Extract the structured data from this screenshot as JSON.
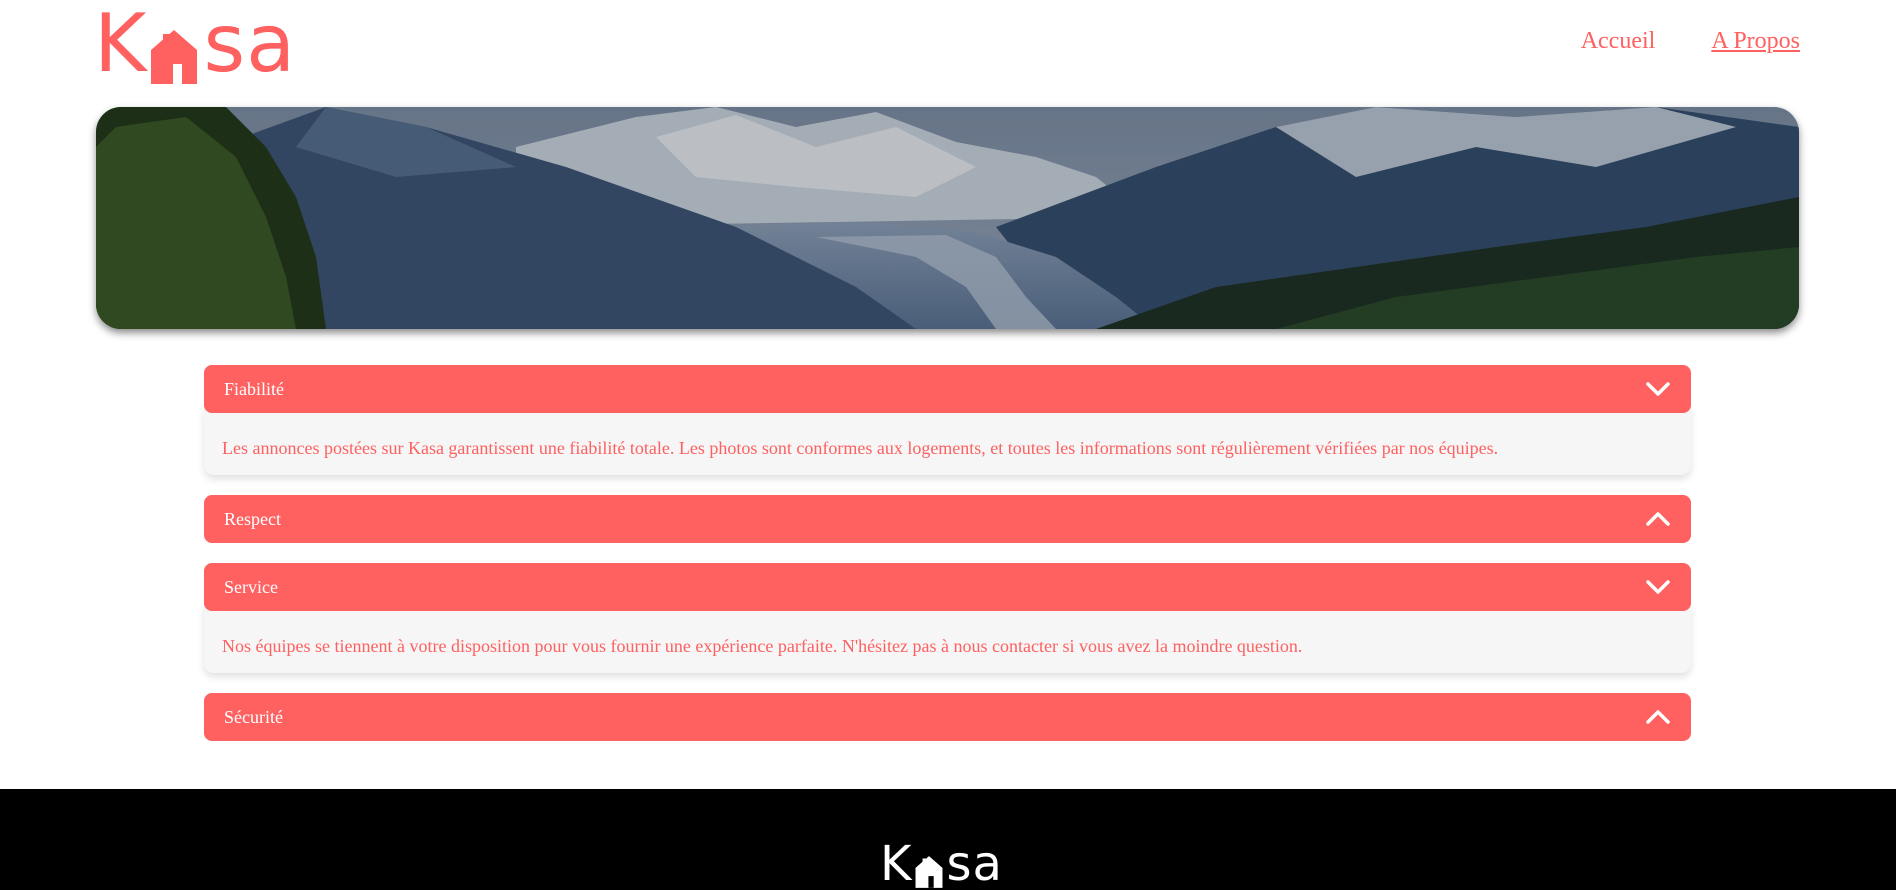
{
  "header": {
    "logo": {
      "text_before": "K",
      "text_after": "sa",
      "brand_color": "#ff6060"
    },
    "nav": [
      {
        "label": "Accueil",
        "active": false
      },
      {
        "label": "A Propos",
        "active": true
      }
    ]
  },
  "collapses": [
    {
      "title": "Fiabilité",
      "expanded": true,
      "chevron": "chevron-down-icon",
      "content": "Les annonces postées sur Kasa garantissent une fiabilité totale. Les photos sont conformes aux logements, et toutes les informations sont régulièrement vérifiées par nos équipes."
    },
    {
      "title": "Respect",
      "expanded": false,
      "chevron": "chevron-up-icon"
    },
    {
      "title": "Service",
      "expanded": true,
      "chevron": "chevron-down-icon",
      "content": "Nos équipes se tiennent à votre disposition pour vous fournir une expérience parfaite. N'hésitez pas à nous contacter si vous avez la moindre question."
    },
    {
      "title": "Sécurité",
      "expanded": false,
      "chevron": "chevron-up-icon"
    }
  ],
  "footer": {
    "logo": {
      "text_before": "K",
      "text_after": "sa"
    }
  },
  "colors": {
    "accent": "#ff6060",
    "panel": "#f6f6f6",
    "footer": "#000000"
  }
}
